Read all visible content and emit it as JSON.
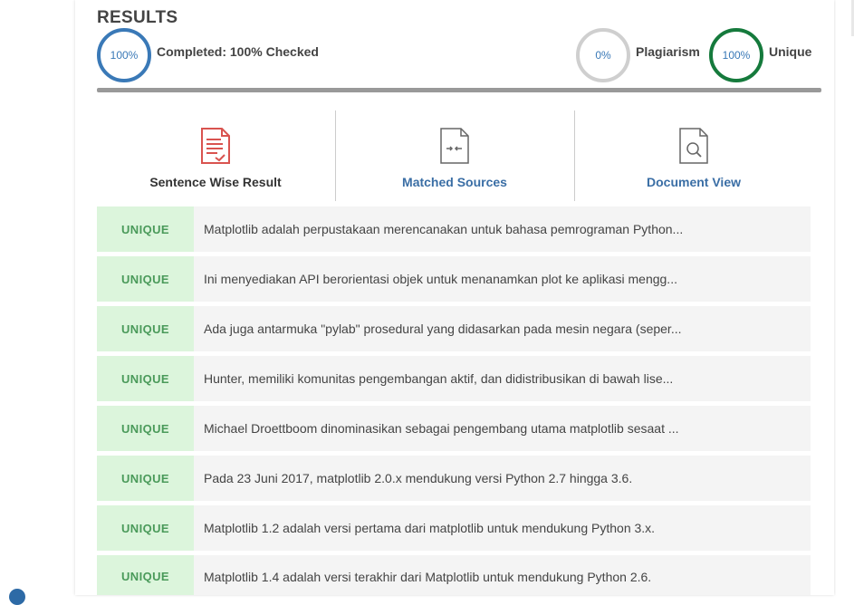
{
  "results": {
    "title": "RESULTS",
    "completed": {
      "value": "100%",
      "label": "Completed: 100% Checked"
    },
    "plagiarism": {
      "value": "0%",
      "label": "Plagiarism"
    },
    "unique": {
      "value": "100%",
      "label": "Unique"
    },
    "progress_fraction": 1.0
  },
  "tabs": [
    {
      "label": "Sentence Wise Result",
      "icon": "document-check-icon",
      "color": "#333333"
    },
    {
      "label": "Matched Sources",
      "icon": "document-compare-icon",
      "color": "#3a6ea5"
    },
    {
      "label": "Document View",
      "icon": "document-search-icon",
      "color": "#3a6ea5"
    }
  ],
  "rows": [
    {
      "status": "UNIQUE",
      "text": "Matplotlib adalah perpustakaan merencanakan untuk bahasa pemrograman Python..."
    },
    {
      "status": "UNIQUE",
      "text": "Ini menyediakan API berorientasi objek untuk menanamkan plot ke aplikasi mengg..."
    },
    {
      "status": "UNIQUE",
      "text": "Ada juga antarmuka \"pylab\" prosedural yang didasarkan pada mesin negara (seper..."
    },
    {
      "status": "UNIQUE",
      "text": "Hunter, memiliki komunitas pengembangan aktif, dan didistribusikan di bawah lise..."
    },
    {
      "status": "UNIQUE",
      "text": "Michael Droettboom dinominasikan sebagai pengembang utama matplotlib sesaat ..."
    },
    {
      "status": "UNIQUE",
      "text": "Pada 23 Juni 2017, matplotlib 2.0.x mendukung versi Python 2.7 hingga 3.6."
    },
    {
      "status": "UNIQUE",
      "text": "Matplotlib 1.2 adalah versi pertama dari matplotlib untuk mendukung Python 3.x."
    },
    {
      "status": "UNIQUE",
      "text": "Matplotlib 1.4 adalah versi terakhir dari Matplotlib untuk mendukung Python 2.6."
    }
  ],
  "colors": {
    "accent_blue": "#3a79b7",
    "accent_green": "#157a3c",
    "unique_bg": "#dcf5dc",
    "unique_text": "#4a9a5a",
    "red_icon": "#d9534f"
  }
}
